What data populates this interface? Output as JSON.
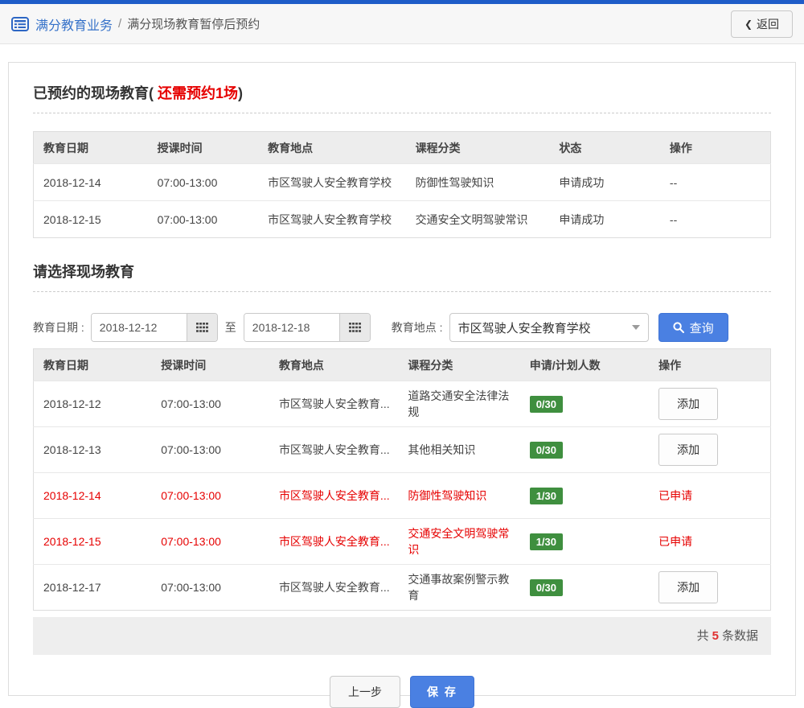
{
  "colors": {
    "accent_blue": "#1e5cc8",
    "button_blue": "#4a80e2",
    "badge_green": "#3f8f3f",
    "alert_red": "#e60000"
  },
  "header": {
    "breadcrumb_root": "满分教育业务",
    "breadcrumb_sep": "/",
    "breadcrumb_current": "满分现场教育暂停后预约",
    "back_chevron": "❮",
    "back_label": "返回"
  },
  "booked": {
    "title_prefix": "已预约的现场教育( ",
    "title_highlight": "还需预约1场",
    "title_suffix": ")",
    "table": {
      "headers": [
        "教育日期",
        "授课时间",
        "教育地点",
        "课程分类",
        "状态",
        "操作"
      ],
      "rows": [
        {
          "date": "2018-12-14",
          "time": "07:00-13:00",
          "place": "市区驾驶人安全教育学校",
          "course": "防御性驾驶知识",
          "status": "申请成功",
          "action": "--"
        },
        {
          "date": "2018-12-15",
          "time": "07:00-13:00",
          "place": "市区驾驶人安全教育学校",
          "course": "交通安全文明驾驶常识",
          "status": "申请成功",
          "action": "--"
        }
      ]
    }
  },
  "select": {
    "title": "请选择现场教育",
    "filter": {
      "date_label": "教育日期 :",
      "date_from": "2018-12-12",
      "to_label": "至",
      "date_to": "2018-12-18",
      "place_label": "教育地点 :",
      "place_value": "市区驾驶人安全教育学校",
      "search_label": "查询"
    },
    "table": {
      "headers": [
        "教育日期",
        "授课时间",
        "教育地点",
        "课程分类",
        "申请/计划人数",
        "操作"
      ],
      "rows": [
        {
          "date": "2018-12-12",
          "time": "07:00-13:00",
          "place": "市区驾驶人安全教育...",
          "course": "道路交通安全法律法规",
          "quota": "0/30",
          "action": "添加"
        },
        {
          "date": "2018-12-13",
          "time": "07:00-13:00",
          "place": "市区驾驶人安全教育...",
          "course": "其他相关知识",
          "quota": "0/30",
          "action": "添加"
        },
        {
          "date": "2018-12-14",
          "time": "07:00-13:00",
          "place": "市区驾驶人安全教育...",
          "course": "防御性驾驶知识",
          "quota": "1/30",
          "action": "已申请"
        },
        {
          "date": "2018-12-15",
          "time": "07:00-13:00",
          "place": "市区驾驶人安全教育...",
          "course": "交通安全文明驾驶常识",
          "quota": "1/30",
          "action": "已申请"
        },
        {
          "date": "2018-12-17",
          "time": "07:00-13:00",
          "place": "市区驾驶人安全教育...",
          "course": "交通事故案例警示教育",
          "quota": "0/30",
          "action": "添加"
        }
      ]
    },
    "summary": {
      "prefix": "共",
      "count": "5",
      "suffix": "条数据"
    }
  },
  "footer_buttons": {
    "prev": "上一步",
    "save": "保 存"
  }
}
